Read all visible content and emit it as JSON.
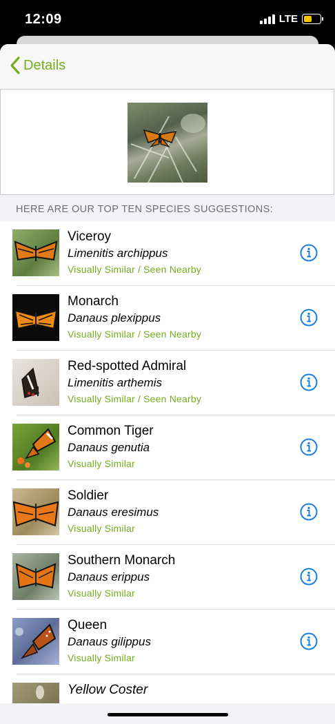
{
  "status_bar": {
    "time": "12:09",
    "network": "LTE"
  },
  "nav": {
    "back_label": "Details"
  },
  "section_header": "HERE ARE OUR TOP TEN SPECIES SUGGESTIONS:",
  "suggestions": [
    {
      "common": "Viceroy",
      "scientific": "Limenitis archippus",
      "match": "Visually Similar / Seen Nearby"
    },
    {
      "common": "Monarch",
      "scientific": "Danaus plexippus",
      "match": "Visually Similar / Seen Nearby"
    },
    {
      "common": "Red-spotted Admiral",
      "scientific": "Limenitis arthemis",
      "match": "Visually Similar / Seen Nearby"
    },
    {
      "common": "Common Tiger",
      "scientific": "Danaus genutia",
      "match": "Visually Similar"
    },
    {
      "common": "Soldier",
      "scientific": "Danaus eresimus",
      "match": "Visually Similar"
    },
    {
      "common": "Southern Monarch",
      "scientific": "Danaus erippus",
      "match": "Visually Similar"
    },
    {
      "common": "Queen",
      "scientific": "Danaus gilippus",
      "match": "Visually Similar"
    },
    {
      "common": "Yellow Coster"
    }
  ],
  "colors": {
    "accent": "#74ad1c",
    "info": "#1a7ee8"
  }
}
